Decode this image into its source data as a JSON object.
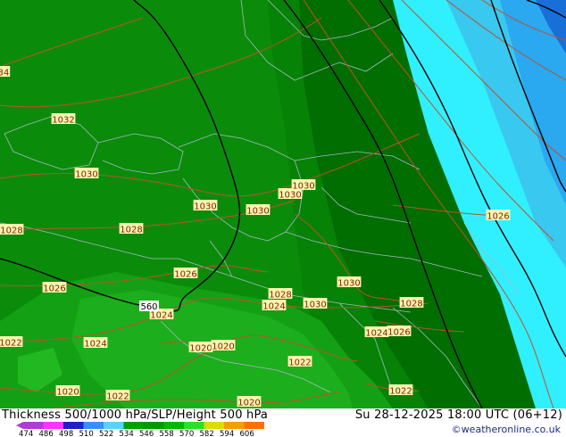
{
  "map": {
    "contour_color": "#c0502a",
    "border_color": "#aab8c8",
    "thickness_line_color": "#000000",
    "isobar_labels": [
      {
        "id": "p1032a",
        "text": "1032"
      },
      {
        "id": "p34",
        "text": "34"
      },
      {
        "id": "p1030a",
        "text": "1030"
      },
      {
        "id": "p1030b",
        "text": "1030"
      },
      {
        "id": "p1030c",
        "text": "1030"
      },
      {
        "id": "p1030d",
        "text": "1030"
      },
      {
        "id": "p1030e",
        "text": "1030"
      },
      {
        "id": "p1030f",
        "text": "1030"
      },
      {
        "id": "p1026a",
        "text": "1026"
      },
      {
        "id": "p1028a",
        "text": "1028"
      },
      {
        "id": "p1028b",
        "text": "1028"
      },
      {
        "id": "p1028c",
        "text": "1028"
      },
      {
        "id": "p1028d",
        "text": "1028"
      },
      {
        "id": "p1026b",
        "text": "1026"
      },
      {
        "id": "p1026c",
        "text": "1026"
      },
      {
        "id": "p1024a",
        "text": "1024"
      },
      {
        "id": "p1024b",
        "text": "1024"
      },
      {
        "id": "p1024c",
        "text": "1024"
      },
      {
        "id": "p1024d",
        "text": "1024"
      },
      {
        "id": "p1022a",
        "text": "1022"
      },
      {
        "id": "p1022b",
        "text": "1022"
      },
      {
        "id": "p1022c",
        "text": "1022"
      },
      {
        "id": "p1022d",
        "text": "1022"
      },
      {
        "id": "p1020a",
        "text": "1020"
      },
      {
        "id": "p1020b",
        "text": "1020"
      },
      {
        "id": "p1020c",
        "text": "1020"
      },
      {
        "id": "p1026d",
        "text": "1026"
      },
      {
        "id": "p1030g",
        "text": "1030"
      },
      {
        "id": "p1020d",
        "text": "1020"
      }
    ],
    "thickness_label": "560"
  },
  "footer": {
    "title": "Thickness 500/1000 hPa/SLP/Height 500 hPa",
    "valid_time": "Su 28-12-2025 18:00 UTC (06+12)",
    "credit": "©weatheronline.co.uk"
  },
  "legend": {
    "ticks": [
      "474",
      "486",
      "498",
      "510",
      "522",
      "534",
      "546",
      "558",
      "570",
      "582",
      "594",
      "606"
    ],
    "colors": [
      "#b03cd8",
      "#ff33ff",
      "#2020c8",
      "#3c8cff",
      "#5ad2ff",
      "#00a000",
      "#009a00",
      "#00b800",
      "#28e028",
      "#dcdc00",
      "#f0a000",
      "#ff7000"
    ]
  }
}
